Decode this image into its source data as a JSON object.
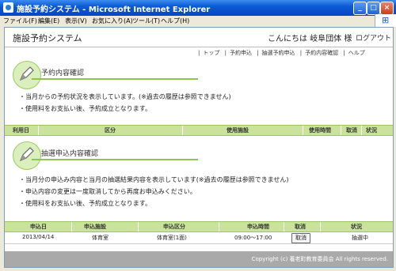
{
  "window": {
    "title": "施設予約システム - Microsoft Internet Explorer",
    "buttons": {
      "minimize": "_",
      "maximize": "□",
      "close": "×"
    }
  },
  "menubar": [
    "ファイル(F)",
    "編集(E)",
    "表示(V)",
    "お気に入り(A)",
    "ツール(T)",
    "ヘルプ(H)"
  ],
  "header": {
    "system_name": "施設予約システム",
    "greeting": "こんにちは 岐阜団体 様",
    "logout": "ログアウト"
  },
  "nav": [
    "トップ",
    "予約申込",
    "抽選予約申込",
    "予約内容確認",
    "ヘルプ"
  ],
  "reservation_section": {
    "title": "予約内容確認",
    "bullets": [
      "当月からの予約状況を表示しています。(※過去の履歴は参照できません)",
      "使用料をお支払い後、予約成立となります。"
    ],
    "columns": [
      "利用日",
      "区分",
      "使用施設",
      "使用時間",
      "取消",
      "状況"
    ]
  },
  "lottery_section": {
    "title": "抽選申込内容確認",
    "bullets": [
      "当月分の申込み内容と当月の抽選結果内容を表示しています(※過去の履歴は参照できません)",
      "申込内容の変更は一度取消してから再度お申込みください。",
      "使用料をお支払い後、予約成立となります。"
    ],
    "columns": [
      "申込日",
      "申込施設",
      "申込区分",
      "申込時間",
      "取消",
      "状況"
    ],
    "rows": [
      {
        "date": "2013/04/14",
        "facility": "体育室",
        "category": "体育室(1面)",
        "time": "09:00～17:00",
        "cancel": "取消",
        "status": "抽選中"
      }
    ]
  },
  "footer": {
    "copyright": "Copyright (c) 養老町教育委員会 All rights reserved."
  }
}
